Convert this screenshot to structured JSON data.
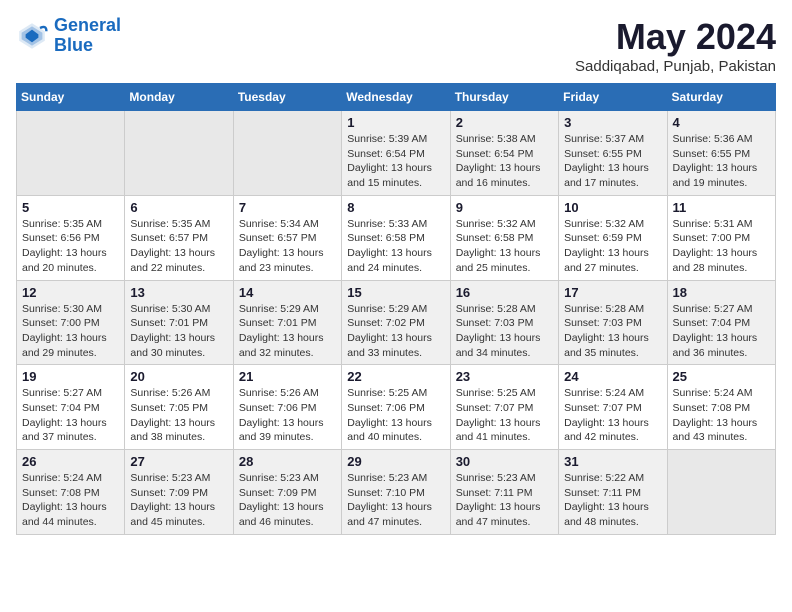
{
  "logo": {
    "line1": "General",
    "line2": "Blue"
  },
  "title": "May 2024",
  "location": "Saddiqabad, Punjab, Pakistan",
  "weekdays": [
    "Sunday",
    "Monday",
    "Tuesday",
    "Wednesday",
    "Thursday",
    "Friday",
    "Saturday"
  ],
  "weeks": [
    [
      {
        "day": "",
        "info": ""
      },
      {
        "day": "",
        "info": ""
      },
      {
        "day": "",
        "info": ""
      },
      {
        "day": "1",
        "info": "Sunrise: 5:39 AM\nSunset: 6:54 PM\nDaylight: 13 hours and 15 minutes."
      },
      {
        "day": "2",
        "info": "Sunrise: 5:38 AM\nSunset: 6:54 PM\nDaylight: 13 hours and 16 minutes."
      },
      {
        "day": "3",
        "info": "Sunrise: 5:37 AM\nSunset: 6:55 PM\nDaylight: 13 hours and 17 minutes."
      },
      {
        "day": "4",
        "info": "Sunrise: 5:36 AM\nSunset: 6:55 PM\nDaylight: 13 hours and 19 minutes."
      }
    ],
    [
      {
        "day": "5",
        "info": "Sunrise: 5:35 AM\nSunset: 6:56 PM\nDaylight: 13 hours and 20 minutes."
      },
      {
        "day": "6",
        "info": "Sunrise: 5:35 AM\nSunset: 6:57 PM\nDaylight: 13 hours and 22 minutes."
      },
      {
        "day": "7",
        "info": "Sunrise: 5:34 AM\nSunset: 6:57 PM\nDaylight: 13 hours and 23 minutes."
      },
      {
        "day": "8",
        "info": "Sunrise: 5:33 AM\nSunset: 6:58 PM\nDaylight: 13 hours and 24 minutes."
      },
      {
        "day": "9",
        "info": "Sunrise: 5:32 AM\nSunset: 6:58 PM\nDaylight: 13 hours and 25 minutes."
      },
      {
        "day": "10",
        "info": "Sunrise: 5:32 AM\nSunset: 6:59 PM\nDaylight: 13 hours and 27 minutes."
      },
      {
        "day": "11",
        "info": "Sunrise: 5:31 AM\nSunset: 7:00 PM\nDaylight: 13 hours and 28 minutes."
      }
    ],
    [
      {
        "day": "12",
        "info": "Sunrise: 5:30 AM\nSunset: 7:00 PM\nDaylight: 13 hours and 29 minutes."
      },
      {
        "day": "13",
        "info": "Sunrise: 5:30 AM\nSunset: 7:01 PM\nDaylight: 13 hours and 30 minutes."
      },
      {
        "day": "14",
        "info": "Sunrise: 5:29 AM\nSunset: 7:01 PM\nDaylight: 13 hours and 32 minutes."
      },
      {
        "day": "15",
        "info": "Sunrise: 5:29 AM\nSunset: 7:02 PM\nDaylight: 13 hours and 33 minutes."
      },
      {
        "day": "16",
        "info": "Sunrise: 5:28 AM\nSunset: 7:03 PM\nDaylight: 13 hours and 34 minutes."
      },
      {
        "day": "17",
        "info": "Sunrise: 5:28 AM\nSunset: 7:03 PM\nDaylight: 13 hours and 35 minutes."
      },
      {
        "day": "18",
        "info": "Sunrise: 5:27 AM\nSunset: 7:04 PM\nDaylight: 13 hours and 36 minutes."
      }
    ],
    [
      {
        "day": "19",
        "info": "Sunrise: 5:27 AM\nSunset: 7:04 PM\nDaylight: 13 hours and 37 minutes."
      },
      {
        "day": "20",
        "info": "Sunrise: 5:26 AM\nSunset: 7:05 PM\nDaylight: 13 hours and 38 minutes."
      },
      {
        "day": "21",
        "info": "Sunrise: 5:26 AM\nSunset: 7:06 PM\nDaylight: 13 hours and 39 minutes."
      },
      {
        "day": "22",
        "info": "Sunrise: 5:25 AM\nSunset: 7:06 PM\nDaylight: 13 hours and 40 minutes."
      },
      {
        "day": "23",
        "info": "Sunrise: 5:25 AM\nSunset: 7:07 PM\nDaylight: 13 hours and 41 minutes."
      },
      {
        "day": "24",
        "info": "Sunrise: 5:24 AM\nSunset: 7:07 PM\nDaylight: 13 hours and 42 minutes."
      },
      {
        "day": "25",
        "info": "Sunrise: 5:24 AM\nSunset: 7:08 PM\nDaylight: 13 hours and 43 minutes."
      }
    ],
    [
      {
        "day": "26",
        "info": "Sunrise: 5:24 AM\nSunset: 7:08 PM\nDaylight: 13 hours and 44 minutes."
      },
      {
        "day": "27",
        "info": "Sunrise: 5:23 AM\nSunset: 7:09 PM\nDaylight: 13 hours and 45 minutes."
      },
      {
        "day": "28",
        "info": "Sunrise: 5:23 AM\nSunset: 7:09 PM\nDaylight: 13 hours and 46 minutes."
      },
      {
        "day": "29",
        "info": "Sunrise: 5:23 AM\nSunset: 7:10 PM\nDaylight: 13 hours and 47 minutes."
      },
      {
        "day": "30",
        "info": "Sunrise: 5:23 AM\nSunset: 7:11 PM\nDaylight: 13 hours and 47 minutes."
      },
      {
        "day": "31",
        "info": "Sunrise: 5:22 AM\nSunset: 7:11 PM\nDaylight: 13 hours and 48 minutes."
      },
      {
        "day": "",
        "info": ""
      }
    ]
  ],
  "shaded_rows": [
    0,
    2,
    4
  ]
}
